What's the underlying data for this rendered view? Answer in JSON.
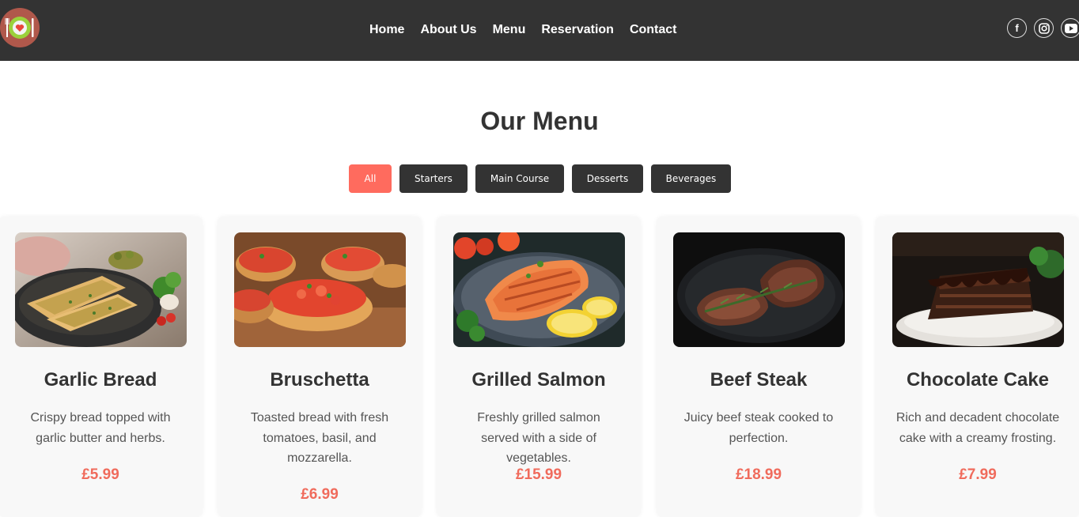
{
  "nav": {
    "links": [
      "Home",
      "About Us",
      "Menu",
      "Reservation",
      "Contact"
    ],
    "social": [
      "facebook-icon",
      "instagram-icon",
      "youtube-icon"
    ]
  },
  "menu": {
    "title": "Our Menu",
    "filters": [
      "All",
      "Starters",
      "Main Course",
      "Desserts",
      "Beverages"
    ],
    "active_filter": "All",
    "items": [
      {
        "name": "Garlic Bread",
        "desc": "Crispy bread topped with garlic butter and herbs.",
        "price": "£5.99"
      },
      {
        "name": "Bruschetta",
        "desc": "Toasted bread with fresh tomatoes, basil, and mozzarella.",
        "price": "£6.99"
      },
      {
        "name": "Grilled Salmon",
        "desc": "Freshly grilled salmon served with a side of vegetables.",
        "price": "£15.99"
      },
      {
        "name": "Beef Steak",
        "desc": "Juicy beef steak cooked to perfection.",
        "price": "£18.99"
      },
      {
        "name": "Chocolate Cake",
        "desc": "Rich and decadent chocolate cake with a creamy frosting.",
        "price": "£7.99"
      }
    ]
  },
  "colors": {
    "nav_bg": "#333333",
    "accent": "#ff6b5e",
    "price": "#f06b5c"
  }
}
